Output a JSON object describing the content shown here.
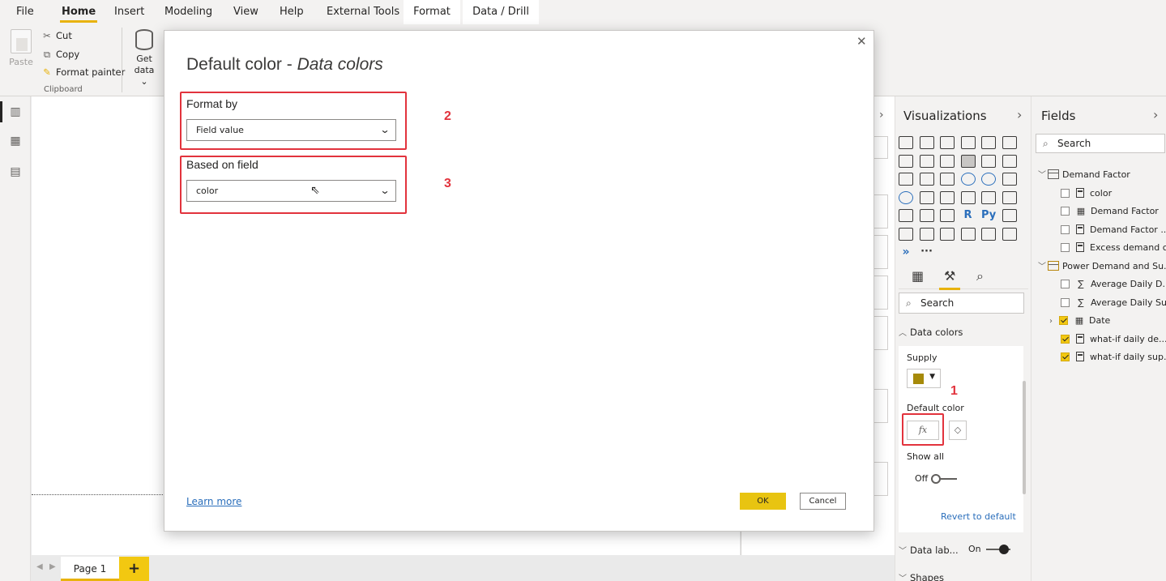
{
  "ribbon": {
    "tabs": [
      "File",
      "Home",
      "Insert",
      "Modeling",
      "View",
      "Help",
      "External Tools",
      "Format",
      "Data / Drill"
    ],
    "active_tab": "Home",
    "paste_label": "Paste",
    "cut_label": "Cut",
    "copy_label": "Copy",
    "format_painter_label": "Format painter",
    "clipboard_group": "Clipboard",
    "get_data_line1": "Get",
    "get_data_line2": "data"
  },
  "dialog": {
    "title_main": "Default color",
    "title_sep": " - ",
    "title_italic": "Data colors",
    "format_by_label": "Format by",
    "format_by_value": "Field value",
    "based_on_label": "Based on field",
    "based_on_value": "color",
    "learn_more": "Learn more",
    "ok": "OK",
    "cancel": "Cancel",
    "step2": "2",
    "step3": "3"
  },
  "visualizations": {
    "title": "Visualizations",
    "search_placeholder": "Search",
    "data_colors_section": "Data colors",
    "supply_label": "Supply",
    "supply_color": "#a68a0a",
    "default_color_label": "Default color",
    "fx_label": "fx",
    "step1": "1",
    "show_all_label": "Show all",
    "show_all_state": "Off",
    "revert_label": "Revert to default",
    "data_labels_section": "Data lab...",
    "data_labels_state": "On",
    "shapes_section": "Shapes"
  },
  "fields": {
    "title": "Fields",
    "search_placeholder": "Search",
    "tables": [
      {
        "name": "Demand Factor",
        "items": [
          {
            "label": "color",
            "checked": false
          },
          {
            "label": "Demand Factor",
            "checked": false
          },
          {
            "label": "Demand Factor ...",
            "checked": false
          },
          {
            "label": "Excess demand c...",
            "checked": false
          }
        ]
      },
      {
        "name": "Power Demand and Su...",
        "items": [
          {
            "label": "Average Daily D...",
            "checked": false
          },
          {
            "label": "Average Daily Su...",
            "checked": false
          },
          {
            "label": "Date",
            "checked": true
          },
          {
            "label": "what-if daily de...",
            "checked": true
          },
          {
            "label": "what-if daily sup...",
            "checked": true
          }
        ]
      }
    ]
  },
  "pages": {
    "page1": "Page 1",
    "add": "+"
  },
  "colors": {
    "accent": "#e8b30e",
    "highlight_red": "#e2333d",
    "link_blue": "#2a6ebb"
  }
}
